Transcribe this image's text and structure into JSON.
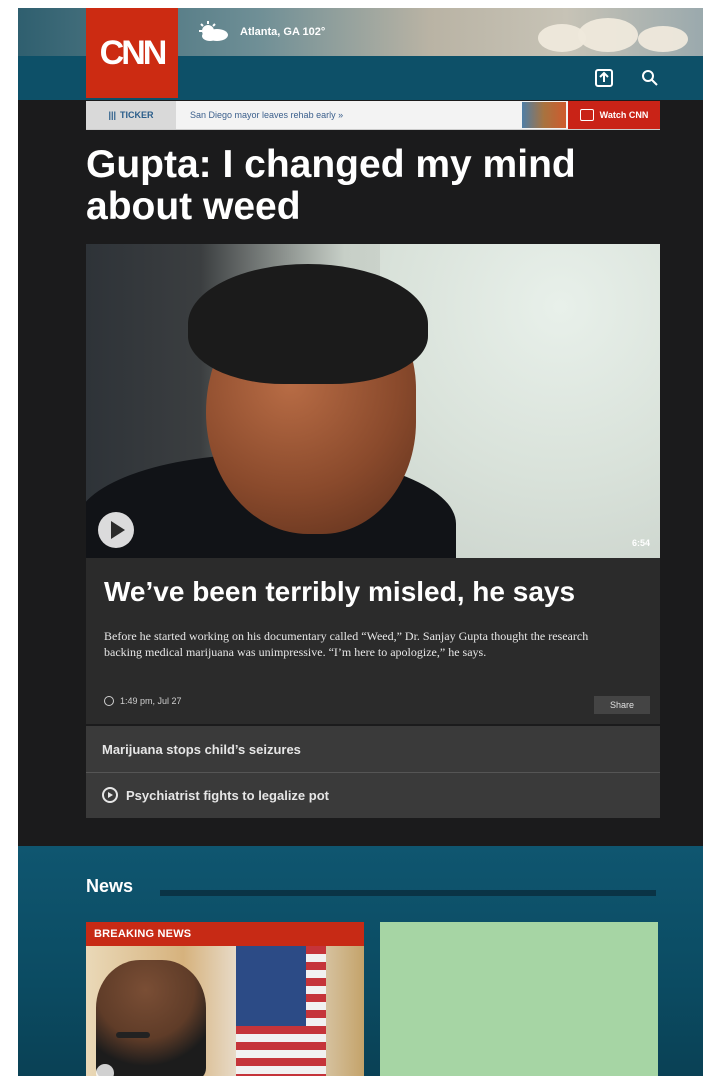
{
  "header": {
    "logo_text": "CNN",
    "weather_text": "Atlanta, GA 102°"
  },
  "ticker": {
    "label": "TICKER",
    "headline": "San Diego mayor leaves rehab early »",
    "watch_label": "Watch CNN"
  },
  "main": {
    "headline": "Gupta: I changed my mind about weed",
    "video_duration": "6:54",
    "story_title": "We’ve been terribly misled, he says",
    "story_description": "Before he started working on his documentary called “Weed,” Dr. Sanjay Gupta thought the research backing medical marijuana was unimpressive. “I’m here to apologize,” he says.",
    "timestamp": "1:49 pm, Jul 27",
    "share_label": "Share",
    "related": [
      {
        "label": "Marijuana stops child’s seizures"
      },
      {
        "label": "Psychiatrist fights to legalize pot"
      }
    ]
  },
  "news": {
    "title": "News",
    "breaking_label": "BREAKING NEWS"
  },
  "colors": {
    "cnn_red": "#cc2b12",
    "nav_teal": "#0d5068",
    "story_bg": "#2b2b2b",
    "news_bg": "#0f5670",
    "green_tile": "#a6d5a4"
  },
  "icons": {
    "weather": "partly-cloudy-icon",
    "share": "share-icon",
    "search": "search-icon",
    "play": "play-icon",
    "watch": "tv-icon",
    "clock": "clock-icon"
  }
}
